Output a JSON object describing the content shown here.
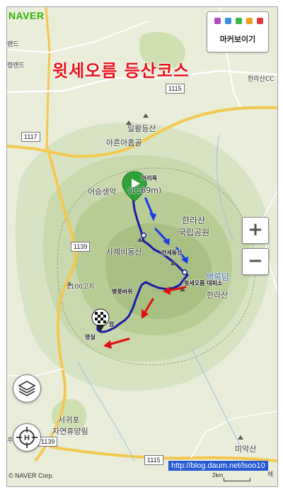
{
  "brand": "NAVER",
  "title": "윗세오름 등산코스",
  "marker_box": {
    "label": "마커보이기",
    "colors": [
      "#b04ac6",
      "#3a8de0",
      "#3bb44a",
      "#f0a020",
      "#e23a3a"
    ]
  },
  "place_labels": {
    "land": "랜드",
    "hallasan_cc_area": "한라산CC",
    "left_edge_1": "령랜드",
    "iljul": "일뢀등산",
    "aheun": "아흔아홉골",
    "eoseung": "어승생악",
    "eorimok_alt": "(1169m)",
    "eorimok": "어리목",
    "hallasan_park_1": "한라산",
    "hallasan_park_2": "국립공원",
    "sajebi": "사제비동산",
    "mansedongsan": "만세동산",
    "baengnokdam": "백록담",
    "witse_shelter": "윗세오름 대피소",
    "hallasan": "한라산",
    "byeongpung": "병풍바위",
    "kochi1100": "1100고지",
    "yeongsil": "영실",
    "yeongsil_am": "암",
    "seogwipo_1": "서귀포",
    "seogwipo_2": "자연휴양림",
    "miaksan": "미악산",
    "hwansang": "헤",
    "left_edge_2": "주"
  },
  "road_shields": [
    "1117",
    "1139",
    "1115",
    "1139",
    "1115"
  ],
  "controls": {
    "zoom_in": "+",
    "zoom_out": "−"
  },
  "credit": "© NAVER Corp.",
  "scale_label": "2km",
  "blog_url": "http://blog.daum.net/lsoo10",
  "route_color": "#1a1aa8",
  "arrow_blue": "#1a3ce6",
  "arrow_red": "#e01010"
}
